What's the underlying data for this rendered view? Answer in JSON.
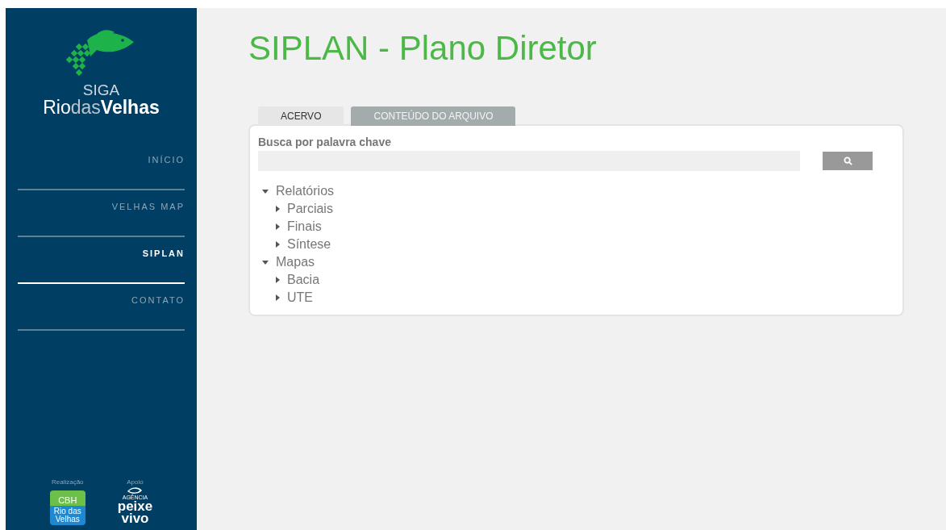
{
  "sidebar": {
    "logo": {
      "line1": "SIGA",
      "line2_a": "Rio",
      "line2_b": "das",
      "line2_c": "Velhas"
    },
    "nav": [
      {
        "label": "INÍCIO",
        "selected": false
      },
      {
        "label": "VELHAS MAP",
        "selected": false
      },
      {
        "label": "SIPLAN",
        "selected": true
      },
      {
        "label": "CONTATO",
        "selected": false
      }
    ],
    "footer": {
      "realizacao": {
        "caption": "Realização",
        "logo_top": "CBH",
        "logo_bottom": "Rio das Velhas"
      },
      "apoio": {
        "caption": "Apoio",
        "logo_small": "AGÊNCIA",
        "logo_line1": "peixe",
        "logo_line2": "vivo"
      }
    }
  },
  "page": {
    "title": "SIPLAN - Plano Diretor",
    "tabs": [
      {
        "label": "ACERVO",
        "selected": true
      },
      {
        "label": "CONTEÚDO DO ARQUIVO",
        "selected": false
      }
    ],
    "search": {
      "label": "Busca por palavra chave"
    },
    "tree": [
      {
        "label": "Relatórios",
        "expanded": true,
        "children": [
          {
            "label": "Parciais",
            "expanded": false
          },
          {
            "label": "Finais",
            "expanded": false
          },
          {
            "label": "Síntese",
            "expanded": false
          }
        ]
      },
      {
        "label": "Mapas",
        "expanded": true,
        "children": [
          {
            "label": "Bacia",
            "expanded": false
          },
          {
            "label": "UTE",
            "expanded": false
          }
        ]
      }
    ]
  }
}
